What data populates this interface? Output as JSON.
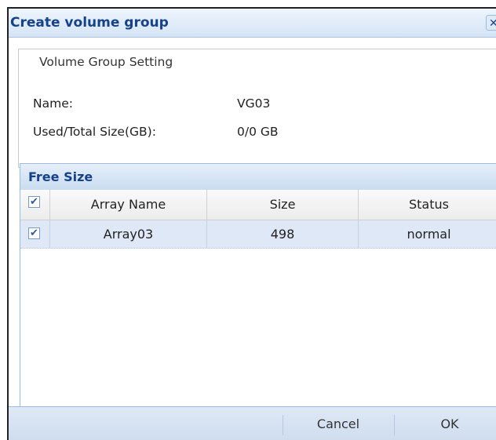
{
  "dialog": {
    "title": "Create volume group",
    "close_icon": "close-x-icon"
  },
  "setting": {
    "legend": "Volume Group Setting",
    "name_label": "Name:",
    "name_value": "VG03",
    "size_label": "Used/Total Size(GB):",
    "size_value": "0/0 GB"
  },
  "grid": {
    "title": "Free Size",
    "columns": [
      "Array Name",
      "Size",
      "Status"
    ],
    "header_checked": true,
    "rows": [
      {
        "checked": true,
        "array_name": "Array03",
        "size": "498",
        "status": "normal"
      }
    ]
  },
  "footer": {
    "cancel_label": "Cancel",
    "ok_label": "OK"
  },
  "colors": {
    "title_text": "#15428b",
    "selected_row": "#dfe8f6",
    "panel_border": "#99bbe8"
  }
}
